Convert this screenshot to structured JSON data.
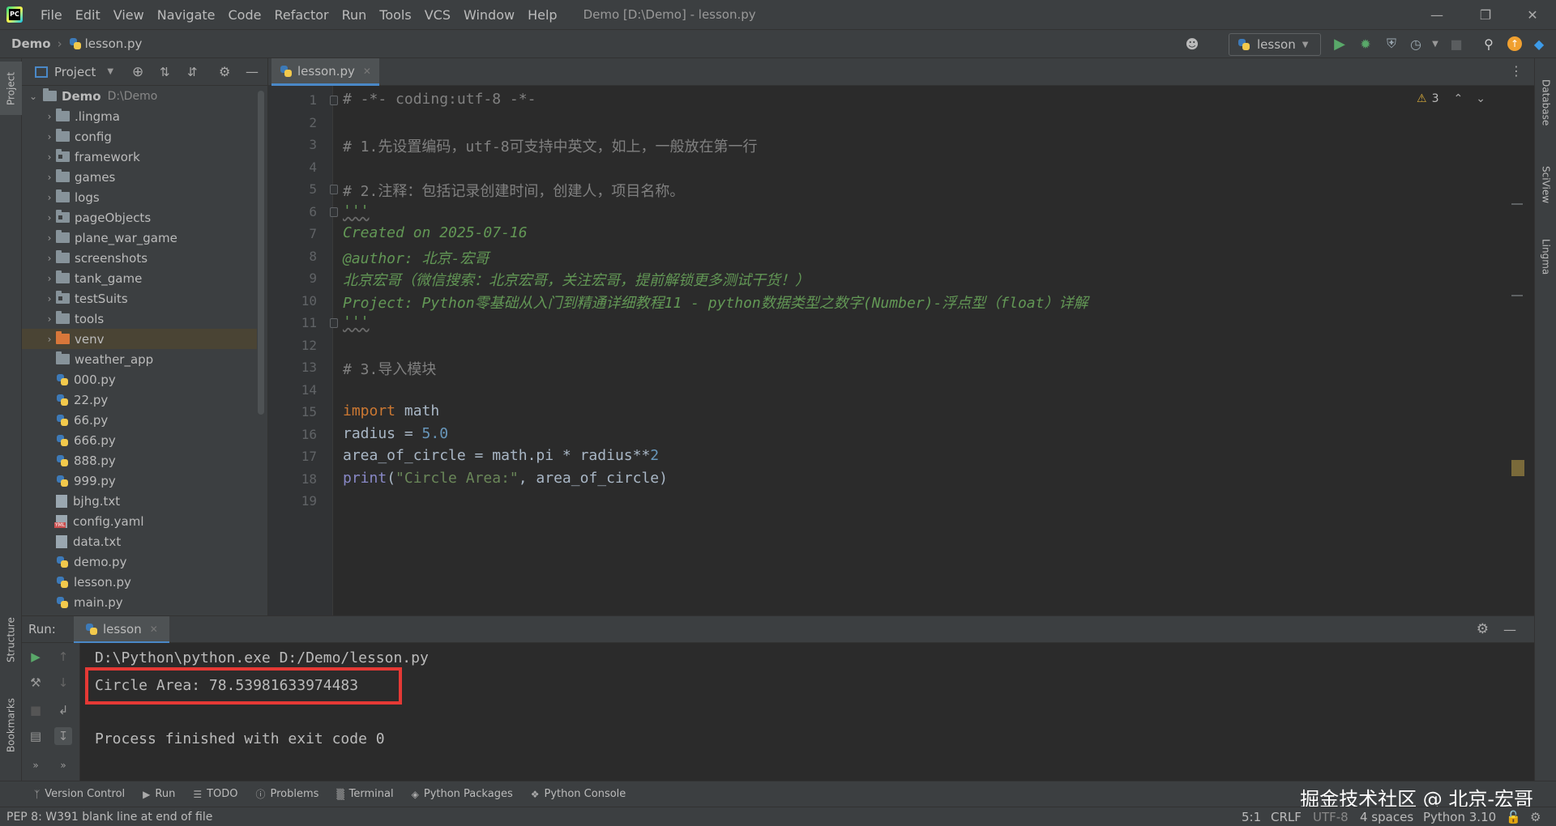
{
  "titlebar": {
    "menus": [
      "File",
      "Edit",
      "View",
      "Navigate",
      "Code",
      "Refactor",
      "Run",
      "Tools",
      "VCS",
      "Window",
      "Help"
    ],
    "window_title": "Demo [D:\\Demo] - lesson.py"
  },
  "navbar": {
    "project": "Demo",
    "file": "lesson.py",
    "run_config": "lesson"
  },
  "project_panel": {
    "title": "Project",
    "root_name": "Demo",
    "root_path": "D:\\Demo",
    "items": [
      {
        "name": ".lingma",
        "kind": "folder"
      },
      {
        "name": "config",
        "kind": "folder"
      },
      {
        "name": "framework",
        "kind": "module"
      },
      {
        "name": "games",
        "kind": "folder"
      },
      {
        "name": "logs",
        "kind": "folder"
      },
      {
        "name": "pageObjects",
        "kind": "module"
      },
      {
        "name": "plane_war_game",
        "kind": "folder"
      },
      {
        "name": "screenshots",
        "kind": "folder"
      },
      {
        "name": "tank_game",
        "kind": "folder"
      },
      {
        "name": "testSuits",
        "kind": "module"
      },
      {
        "name": "tools",
        "kind": "folder"
      },
      {
        "name": "venv",
        "kind": "venv"
      },
      {
        "name": "weather_app",
        "kind": "plain"
      },
      {
        "name": "000.py",
        "kind": "py"
      },
      {
        "name": "22.py",
        "kind": "py"
      },
      {
        "name": "66.py",
        "kind": "py"
      },
      {
        "name": "666.py",
        "kind": "py"
      },
      {
        "name": "888.py",
        "kind": "py"
      },
      {
        "name": "999.py",
        "kind": "py"
      },
      {
        "name": "bjhg.txt",
        "kind": "txt"
      },
      {
        "name": "config.yaml",
        "kind": "yaml"
      },
      {
        "name": "data.txt",
        "kind": "txt"
      },
      {
        "name": "demo.py",
        "kind": "py"
      },
      {
        "name": "lesson.py",
        "kind": "py"
      },
      {
        "name": "main.py",
        "kind": "py"
      }
    ]
  },
  "editor": {
    "tab": "lesson.py",
    "warnings": "3",
    "line_numbers": [
      "1",
      "2",
      "3",
      "4",
      "5",
      "6",
      "7",
      "8",
      "9",
      "10",
      "11",
      "12",
      "13",
      "14",
      "15",
      "16",
      "17",
      "18",
      "19"
    ],
    "lines": {
      "l1": "# -*- coding:utf-8 -*-",
      "l3": "# 1.先设置编码，utf-8可支持中英文，如上，一般放在第一行",
      "l5": "# 2.注释：包括记录创建时间，创建人，项目名称。",
      "l6": "'''",
      "l7": "Created on 2025-07-16",
      "l8": "@author: 北京-宏哥",
      "l9": "北京宏哥（微信搜索：北京宏哥，关注宏哥，提前解锁更多测试干货！）",
      "l10": "Project: Python零基础从入门到精通详细教程11 - python数据类型之数字(Number)-浮点型（float）详解",
      "l11": "'''",
      "l13": "# 3.导入模块",
      "l15_kw": "import",
      "l15_rest": " math",
      "l16_a": "radius = ",
      "l16_num": "5.0",
      "l17_a": "area_of_circle = math.pi * radius**",
      "l17_num": "2",
      "l18_fn": "print",
      "l18_a": "(",
      "l18_str": "\"Circle Area:\"",
      "l18_b": ", area_of_circle)"
    }
  },
  "run_panel": {
    "label": "Run:",
    "tab": "lesson",
    "lines": {
      "cmd": "D:\\Python\\python.exe D:/Demo/lesson.py",
      "result": "Circle Area: 78.53981633974483",
      "exit": "Process finished with exit code 0"
    }
  },
  "bottom_tabs": [
    "Version Control",
    "Run",
    "TODO",
    "Problems",
    "Terminal",
    "Python Packages",
    "Python Console"
  ],
  "watermark": "掘金技术社区 @ 北京-宏哥",
  "statusbar": {
    "message": "PEP 8: W391 blank line at end of file",
    "position": "5:1",
    "line_sep": "CRLF",
    "encoding": "UTF-8",
    "indent": "4 spaces",
    "interpreter": "Python 3.10"
  },
  "side_tabs": {
    "left": [
      "Project",
      "Structure",
      "Bookmarks"
    ],
    "right": [
      "Database",
      "SciView",
      "Lingma"
    ]
  },
  "colors": {
    "accent": "#4a88c7",
    "highlight_box": "#e53935",
    "run_green": "#59a869"
  }
}
